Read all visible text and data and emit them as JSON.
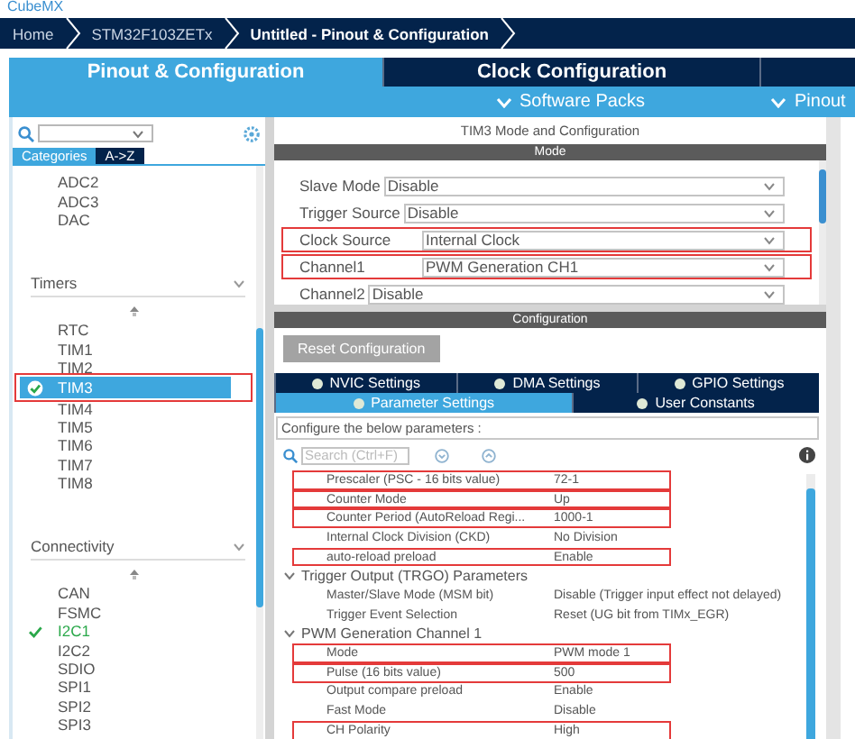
{
  "app": {
    "logo": "CubeMX"
  },
  "breadcrumb": [
    {
      "label": "Home",
      "current": false
    },
    {
      "label": "STM32F103ZETx",
      "current": false
    },
    {
      "label": "Untitled - Pinout & Configuration",
      "current": true
    }
  ],
  "tabs": [
    {
      "label": "Pinout & Configuration",
      "selected": true
    },
    {
      "label": "Clock Configuration",
      "selected": false
    }
  ],
  "menus": [
    "Software Packs",
    "Pinout"
  ],
  "sidebar": {
    "view_tabs": [
      {
        "label": "Categories",
        "selected": true
      },
      {
        "label": "A->Z",
        "selected": false
      }
    ],
    "sections": [
      {
        "items": [
          {
            "label": "ADC2",
            "selected": false,
            "configured": false,
            "highlighted": false
          },
          {
            "label": "ADC3",
            "selected": false,
            "configured": false,
            "highlighted": false
          },
          {
            "label": "DAC",
            "selected": false,
            "configured": false,
            "highlighted": false
          }
        ]
      },
      {
        "title": "Timers",
        "items": [
          {
            "label": "RTC",
            "selected": false,
            "configured": false,
            "highlighted": false
          },
          {
            "label": "TIM1",
            "selected": false,
            "configured": false,
            "highlighted": false
          },
          {
            "label": "TIM2",
            "selected": false,
            "configured": false,
            "highlighted": false
          },
          {
            "label": "TIM3",
            "selected": true,
            "configured": true,
            "highlighted": true
          },
          {
            "label": "TIM4",
            "selected": false,
            "configured": false,
            "highlighted": false
          },
          {
            "label": "TIM5",
            "selected": false,
            "configured": false,
            "highlighted": false
          },
          {
            "label": "TIM6",
            "selected": false,
            "configured": false,
            "highlighted": false
          },
          {
            "label": "TIM7",
            "selected": false,
            "configured": false,
            "highlighted": false
          },
          {
            "label": "TIM8",
            "selected": false,
            "configured": false,
            "highlighted": false
          }
        ]
      },
      {
        "title": "Connectivity",
        "items": [
          {
            "label": "CAN",
            "selected": false,
            "configured": false,
            "highlighted": false
          },
          {
            "label": "FSMC",
            "selected": false,
            "configured": false,
            "highlighted": false
          },
          {
            "label": "I2C1",
            "selected": false,
            "configured": true,
            "highlighted": false
          },
          {
            "label": "I2C2",
            "selected": false,
            "configured": false,
            "highlighted": false
          },
          {
            "label": "SDIO",
            "selected": false,
            "configured": false,
            "highlighted": false
          },
          {
            "label": "SPI1",
            "selected": false,
            "configured": false,
            "highlighted": false
          },
          {
            "label": "SPI2",
            "selected": false,
            "configured": false,
            "highlighted": false
          },
          {
            "label": "SPI3",
            "selected": false,
            "configured": false,
            "highlighted": false
          }
        ]
      }
    ]
  },
  "panel": {
    "title": "TIM3 Mode and Configuration",
    "mode": {
      "heading": "Mode",
      "fields": [
        {
          "label": "Slave Mode",
          "value": "Disable",
          "highlighted": false
        },
        {
          "label": "Trigger Source",
          "value": "Disable",
          "highlighted": false
        },
        {
          "label": "Clock Source",
          "value": "Internal Clock",
          "highlighted": true
        },
        {
          "label": "Channel1",
          "value": "PWM Generation CH1",
          "highlighted": true
        },
        {
          "label": "Channel2",
          "value": "Disable",
          "highlighted": false
        }
      ]
    },
    "configuration": {
      "heading": "Configuration",
      "reset_button": "Reset Configuration",
      "tab_rows": [
        {
          "tabs": [
            {
              "label": "NVIC Settings",
              "selected": false
            },
            {
              "label": "DMA Settings",
              "selected": false
            },
            {
              "label": "GPIO Settings",
              "selected": false
            }
          ]
        },
        {
          "tabs": [
            {
              "label": "Parameter Settings",
              "selected": true
            },
            {
              "label": "User Constants",
              "selected": false
            }
          ]
        }
      ],
      "hint": "Configure the below parameters :",
      "search": {
        "placeholder": "Search (Ctrl+F)"
      },
      "parameters": [
        {
          "kind": "param",
          "label": "Prescaler (PSC - 16 bits value)",
          "value": "72-1",
          "highlighted": true
        },
        {
          "kind": "param",
          "label": "Counter Mode",
          "value": "Up",
          "highlighted": true
        },
        {
          "kind": "param",
          "label": "Counter Period (AutoReload Regi...",
          "value": "1000-1",
          "highlighted": true
        },
        {
          "kind": "param",
          "label": "Internal Clock Division (CKD)",
          "value": "No Division",
          "highlighted": false
        },
        {
          "kind": "param",
          "label": "auto-reload preload",
          "value": "Enable",
          "highlighted": true
        },
        {
          "kind": "group",
          "label": "Trigger Output (TRGO) Parameters"
        },
        {
          "kind": "param",
          "label": "Master/Slave Mode (MSM bit)",
          "value": "Disable (Trigger input effect not delayed)",
          "highlighted": false
        },
        {
          "kind": "param",
          "label": "Trigger Event Selection",
          "value": "Reset (UG bit from TIMx_EGR)",
          "highlighted": false
        },
        {
          "kind": "group",
          "label": "PWM Generation Channel 1"
        },
        {
          "kind": "param",
          "label": "Mode",
          "value": "PWM mode 1",
          "highlighted": true
        },
        {
          "kind": "param",
          "label": "Pulse (16 bits value)",
          "value": "500",
          "highlighted": true
        },
        {
          "kind": "param",
          "label": "Output compare preload",
          "value": "Enable",
          "highlighted": false
        },
        {
          "kind": "param",
          "label": "Fast Mode",
          "value": "Disable",
          "highlighted": false
        },
        {
          "kind": "param",
          "label": "CH Polarity",
          "value": "High",
          "highlighted": true
        }
      ]
    }
  }
}
